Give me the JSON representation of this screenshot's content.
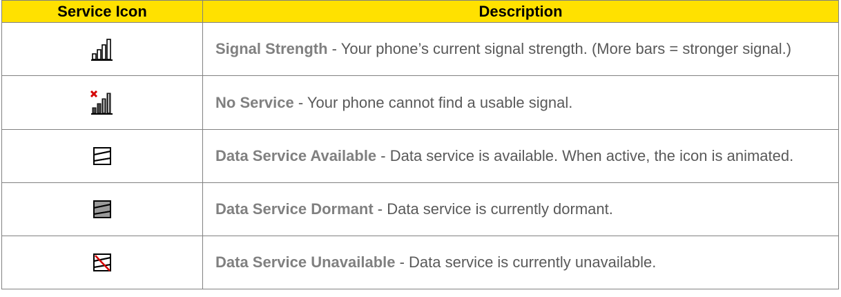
{
  "table": {
    "headers": {
      "icon": "Service Icon",
      "description": "Description"
    },
    "rows": [
      {
        "icon": "signal-strength-icon",
        "title": "Signal Strength",
        "text": " - Your phone’s current signal strength. (More bars = stronger signal.)"
      },
      {
        "icon": "no-service-icon",
        "title": "No Service",
        "text": " - Your phone cannot find a usable signal."
      },
      {
        "icon": "data-service-available-icon",
        "title": "Data Service Available",
        "text": " - Data service is available. When active, the icon is animated."
      },
      {
        "icon": "data-service-dormant-icon",
        "title": "Data Service Dormant",
        "text": " - Data service is currently dormant."
      },
      {
        "icon": "data-service-unavailable-icon",
        "title": "Data Service Unavailable",
        "text": " - Data service is currently unavailable."
      }
    ]
  },
  "colors": {
    "header_bg": "#ffe100",
    "title_text": "#808080",
    "body_text": "#595959",
    "no_service_x": "#d40000"
  }
}
